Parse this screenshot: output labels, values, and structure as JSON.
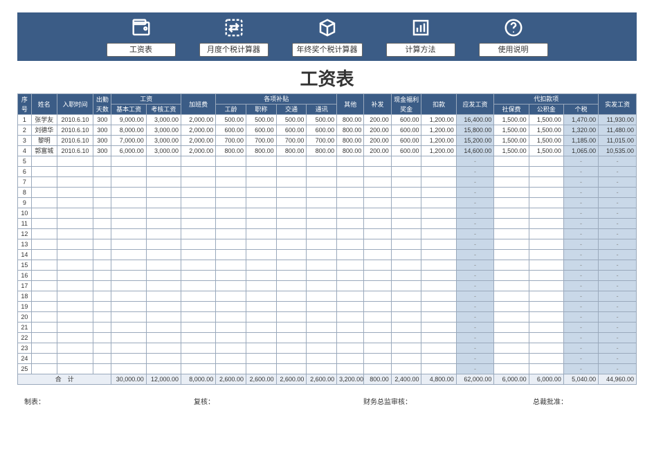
{
  "nav": {
    "items": [
      {
        "icon": "wallet",
        "label": "工资表"
      },
      {
        "icon": "transfer",
        "label": "月度个税计算器"
      },
      {
        "icon": "cube",
        "label": "年终奖个税计算器"
      },
      {
        "icon": "grid",
        "label": "计算方法"
      },
      {
        "icon": "help",
        "label": "使用说明"
      }
    ]
  },
  "title": "工资表",
  "headers": {
    "seq": "序号",
    "name": "姓名",
    "join": "入职时间",
    "days": "出勤天数",
    "salary": "工资",
    "base": "基本工资",
    "perf": "考核工资",
    "overtime": "加班费",
    "allowance": "各项补贴",
    "seniority": "工龄",
    "position": "职称",
    "traffic": "交通",
    "comm": "通讯",
    "other": "其他",
    "reissue": "补发",
    "welfare": "现金福利奖金",
    "deduct": "扣款",
    "gross": "应发工资",
    "withhold": "代扣款项",
    "social": "社保费",
    "fund": "公积金",
    "tax": "个税",
    "net": "实发工资"
  },
  "rows": [
    {
      "seq": 1,
      "name": "张学友",
      "join": "2010.6.10",
      "days": 300,
      "base": "9,000.00",
      "perf": "3,000.00",
      "ot": "2,000.00",
      "sen": "500.00",
      "pos": "500.00",
      "tra": "500.00",
      "com": "500.00",
      "oth": "800.00",
      "rei": "200.00",
      "wel": "600.00",
      "ded": "1,200.00",
      "gross": "16,400.00",
      "soc": "1,500.00",
      "fund": "1,500.00",
      "tax": "1,470.00",
      "net": "11,930.00"
    },
    {
      "seq": 2,
      "name": "刘德华",
      "join": "2010.6.10",
      "days": 300,
      "base": "8,000.00",
      "perf": "3,000.00",
      "ot": "2,000.00",
      "sen": "600.00",
      "pos": "600.00",
      "tra": "600.00",
      "com": "600.00",
      "oth": "800.00",
      "rei": "200.00",
      "wel": "600.00",
      "ded": "1,200.00",
      "gross": "15,800.00",
      "soc": "1,500.00",
      "fund": "1,500.00",
      "tax": "1,320.00",
      "net": "11,480.00"
    },
    {
      "seq": 3,
      "name": "黎明",
      "join": "2010.6.10",
      "days": 300,
      "base": "7,000.00",
      "perf": "3,000.00",
      "ot": "2,000.00",
      "sen": "700.00",
      "pos": "700.00",
      "tra": "700.00",
      "com": "700.00",
      "oth": "800.00",
      "rei": "200.00",
      "wel": "600.00",
      "ded": "1,200.00",
      "gross": "15,200.00",
      "soc": "1,500.00",
      "fund": "1,500.00",
      "tax": "1,185.00",
      "net": "11,015.00"
    },
    {
      "seq": 4,
      "name": "郭富城",
      "join": "2010.6.10",
      "days": 300,
      "base": "6,000.00",
      "perf": "3,000.00",
      "ot": "2,000.00",
      "sen": "800.00",
      "pos": "800.00",
      "tra": "800.00",
      "com": "800.00",
      "oth": "800.00",
      "rei": "200.00",
      "wel": "600.00",
      "ded": "1,200.00",
      "gross": "14,600.00",
      "soc": "1,500.00",
      "fund": "1,500.00",
      "tax": "1,065.00",
      "net": "10,535.00"
    }
  ],
  "empty_start": 5,
  "empty_end": 25,
  "total": {
    "label": "合　计",
    "base": "30,000.00",
    "perf": "12,000.00",
    "ot": "8,000.00",
    "sen": "2,600.00",
    "pos": "2,600.00",
    "tra": "2,600.00",
    "com": "2,600.00",
    "oth": "3,200.00",
    "rei": "800.00",
    "wel": "2,400.00",
    "ded": "4,800.00",
    "gross": "62,000.00",
    "soc": "6,000.00",
    "fund": "6,000.00",
    "tax": "5,040.00",
    "net": "44,960.00"
  },
  "sign": {
    "a": "制表：",
    "b": "复核：",
    "c": "财务总监审核：",
    "d": "总裁批准："
  },
  "chart_data": {
    "type": "table",
    "title": "工资表",
    "columns": [
      "序号",
      "姓名",
      "入职时间",
      "出勤天数",
      "基本工资",
      "考核工资",
      "加班费",
      "工龄",
      "职称",
      "交通",
      "通讯",
      "其他",
      "补发",
      "现金福利奖金",
      "扣款",
      "应发工资",
      "社保费",
      "公积金",
      "个税",
      "实发工资"
    ],
    "rows": [
      [
        1,
        "张学友",
        "2010.6.10",
        300,
        9000,
        3000,
        2000,
        500,
        500,
        500,
        500,
        800,
        200,
        600,
        1200,
        16400,
        1500,
        1500,
        1470,
        11930
      ],
      [
        2,
        "刘德华",
        "2010.6.10",
        300,
        8000,
        3000,
        2000,
        600,
        600,
        600,
        600,
        800,
        200,
        600,
        1200,
        15800,
        1500,
        1500,
        1320,
        11480
      ],
      [
        3,
        "黎明",
        "2010.6.10",
        300,
        7000,
        3000,
        2000,
        700,
        700,
        700,
        700,
        800,
        200,
        600,
        1200,
        15200,
        1500,
        1500,
        1185,
        11015
      ],
      [
        4,
        "郭富城",
        "2010.6.10",
        300,
        6000,
        3000,
        2000,
        800,
        800,
        800,
        800,
        800,
        200,
        600,
        1200,
        14600,
        1500,
        1500,
        1065,
        10535
      ]
    ],
    "totals": {
      "基本工资": 30000,
      "考核工资": 12000,
      "加班费": 8000,
      "工龄": 2600,
      "职称": 2600,
      "交通": 2600,
      "通讯": 2600,
      "其他": 3200,
      "补发": 800,
      "现金福利奖金": 2400,
      "扣款": 4800,
      "应发工资": 62000,
      "社保费": 6000,
      "公积金": 6000,
      "个税": 5040,
      "实发工资": 44960
    }
  }
}
